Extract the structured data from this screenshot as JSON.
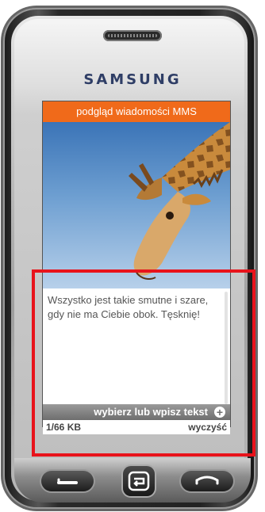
{
  "phone": {
    "brand": "SAMSUNG"
  },
  "screen": {
    "header_title": "podgląd wiadomości MMS",
    "message_text": "Wszystko jest takie smutne i szare, gdy nie ma Ciebie obok. Tęsknię!",
    "action_label": "wybierz lub wpisz tekst",
    "size_label": "1/66 KB",
    "clear_label": "wyczyść"
  },
  "colors": {
    "header": "#f06a1a",
    "highlight": "#e8131b",
    "brand_text": "#2f3e66"
  },
  "icons": {
    "action": "plus-circle-icon",
    "call": "call-icon",
    "back": "back-icon",
    "end": "end-call-icon"
  }
}
